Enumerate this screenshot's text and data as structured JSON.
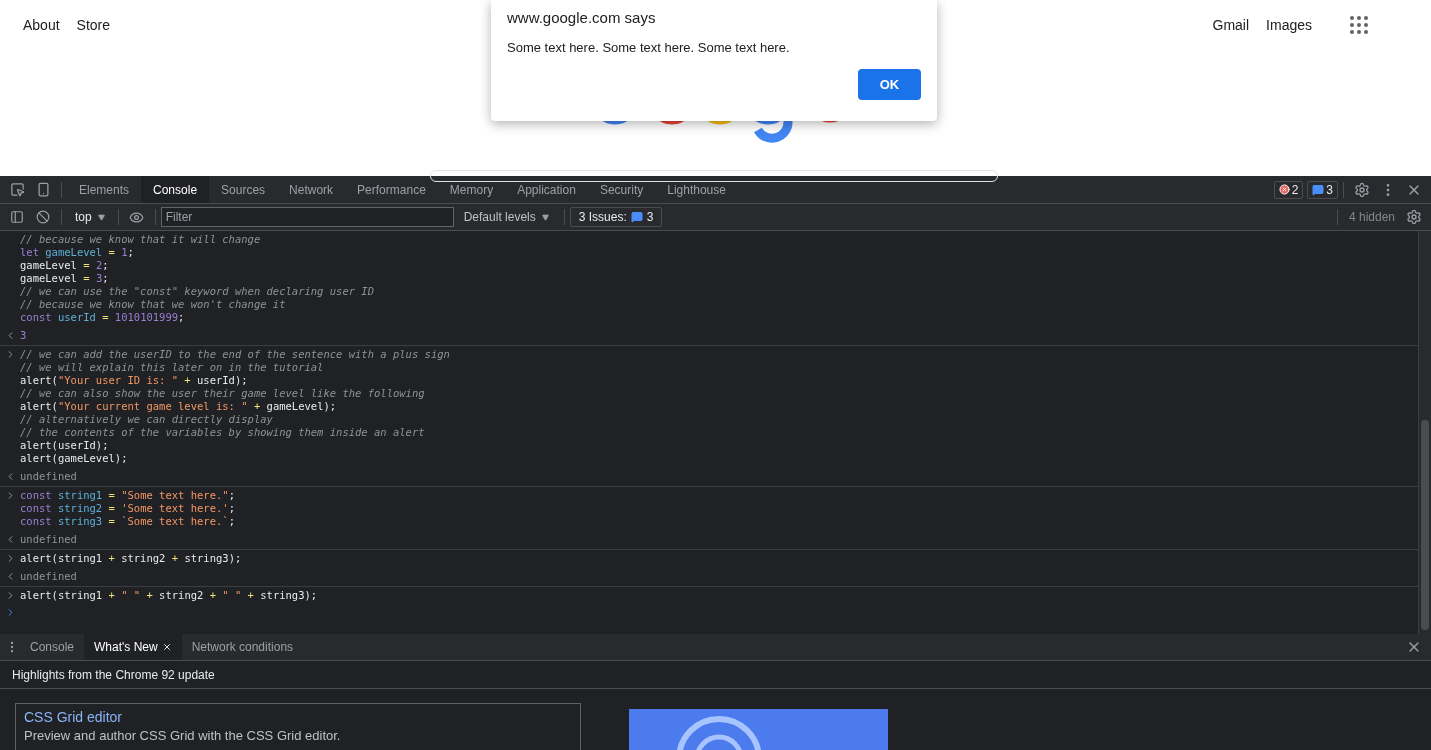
{
  "page": {
    "nav_left": [
      "About",
      "Store"
    ],
    "nav_right": [
      "Gmail",
      "Images"
    ]
  },
  "alert": {
    "origin": "www.google.com says",
    "message": "Some text here. Some text here. Some text here.",
    "button": "OK"
  },
  "devtools": {
    "tabs": [
      {
        "label": "Elements",
        "selected": false
      },
      {
        "label": "Console",
        "selected": true
      },
      {
        "label": "Sources",
        "selected": false
      },
      {
        "label": "Network",
        "selected": false
      },
      {
        "label": "Performance",
        "selected": false
      },
      {
        "label": "Memory",
        "selected": false
      },
      {
        "label": "Application",
        "selected": false
      },
      {
        "label": "Security",
        "selected": false
      },
      {
        "label": "Lighthouse",
        "selected": false
      }
    ],
    "error_count": "2",
    "message_count": "3"
  },
  "console_toolbar": {
    "context": "top",
    "filter_placeholder": "Filter",
    "levels": "Default levels",
    "issues_label": "3 Issues:",
    "issues_count": "3",
    "hidden": "4 hidden"
  },
  "console": {
    "entries": [
      {
        "kind": "continued",
        "lines": [
          [
            {
              "kind": "comment",
              "text": "// because we know that it will change"
            }
          ],
          [
            {
              "kind": "keyword",
              "text": "let "
            },
            {
              "kind": "variable",
              "text": "gameLevel"
            },
            {
              "kind": "operator",
              "text": " = "
            },
            {
              "kind": "number",
              "text": "1"
            },
            {
              "kind": "plain",
              "text": ";"
            }
          ],
          [
            {
              "kind": "plain",
              "text": "gameLevel"
            },
            {
              "kind": "operator",
              "text": " = "
            },
            {
              "kind": "number",
              "text": "2"
            },
            {
              "kind": "plain",
              "text": ";"
            }
          ],
          [
            {
              "kind": "plain",
              "text": "gameLevel"
            },
            {
              "kind": "operator",
              "text": " = "
            },
            {
              "kind": "number",
              "text": "3"
            },
            {
              "kind": "plain",
              "text": ";"
            }
          ],
          [
            {
              "kind": "comment",
              "text": "// we can use the \"const\" keyword when declaring user ID"
            }
          ],
          [
            {
              "kind": "comment",
              "text": "// because we know that we won't change it"
            }
          ],
          [
            {
              "kind": "keyword",
              "text": "const "
            },
            {
              "kind": "variable",
              "text": "userId"
            },
            {
              "kind": "operator",
              "text": " = "
            },
            {
              "kind": "number",
              "text": "1010101999"
            },
            {
              "kind": "plain",
              "text": ";"
            }
          ]
        ]
      },
      {
        "kind": "result",
        "lines": [
          [
            {
              "kind": "number",
              "text": "3"
            }
          ]
        ]
      },
      {
        "kind": "input",
        "lines": [
          [
            {
              "kind": "comment",
              "text": "// we can add the userID to the end of the sentence with a plus sign"
            }
          ],
          [
            {
              "kind": "comment",
              "text": "// we will explain this later on in the tutorial"
            }
          ],
          [
            {
              "kind": "plain",
              "text": "alert("
            },
            {
              "kind": "string",
              "text": "\"Your user ID is: \""
            },
            {
              "kind": "operator",
              "text": " + "
            },
            {
              "kind": "plain",
              "text": "userId);"
            }
          ],
          [
            {
              "kind": "comment",
              "text": "// we can also show the user their game level like the following"
            }
          ],
          [
            {
              "kind": "plain",
              "text": "alert("
            },
            {
              "kind": "string",
              "text": "\"Your current game level is: \""
            },
            {
              "kind": "operator",
              "text": " + "
            },
            {
              "kind": "plain",
              "text": "gameLevel);"
            }
          ],
          [
            {
              "kind": "comment",
              "text": "// alternatively we can directly display"
            }
          ],
          [
            {
              "kind": "comment",
              "text": "// the contents of the variables by showing them inside an alert"
            }
          ],
          [
            {
              "kind": "plain",
              "text": "alert(userId);"
            }
          ],
          [
            {
              "kind": "plain",
              "text": "alert(gameLevel);"
            }
          ]
        ]
      },
      {
        "kind": "result",
        "lines": [
          [
            {
              "kind": "undefined",
              "text": "undefined"
            }
          ]
        ]
      },
      {
        "kind": "input",
        "lines": [
          [
            {
              "kind": "keyword",
              "text": "const "
            },
            {
              "kind": "variable",
              "text": "string1"
            },
            {
              "kind": "operator",
              "text": " = "
            },
            {
              "kind": "string",
              "text": "\"Some text here.\""
            },
            {
              "kind": "plain",
              "text": ";"
            }
          ],
          [
            {
              "kind": "keyword",
              "text": "const "
            },
            {
              "kind": "variable",
              "text": "string2"
            },
            {
              "kind": "operator",
              "text": " = "
            },
            {
              "kind": "string",
              "text": "'Some text here.'"
            },
            {
              "kind": "plain",
              "text": ";"
            }
          ],
          [
            {
              "kind": "keyword",
              "text": "const "
            },
            {
              "kind": "variable",
              "text": "string3"
            },
            {
              "kind": "operator",
              "text": " = "
            },
            {
              "kind": "string",
              "text": "`Some text here.`"
            },
            {
              "kind": "plain",
              "text": ";"
            }
          ]
        ]
      },
      {
        "kind": "result",
        "lines": [
          [
            {
              "kind": "undefined",
              "text": "undefined"
            }
          ]
        ]
      },
      {
        "kind": "input",
        "lines": [
          [
            {
              "kind": "plain",
              "text": "alert(string1"
            },
            {
              "kind": "operator",
              "text": " + "
            },
            {
              "kind": "plain",
              "text": "string2"
            },
            {
              "kind": "operator",
              "text": " + "
            },
            {
              "kind": "plain",
              "text": "string3);"
            }
          ]
        ]
      },
      {
        "kind": "result",
        "lines": [
          [
            {
              "kind": "undefined",
              "text": "undefined"
            }
          ]
        ]
      },
      {
        "kind": "input",
        "lines": [
          [
            {
              "kind": "plain",
              "text": "alert(string1"
            },
            {
              "kind": "operator",
              "text": " + "
            },
            {
              "kind": "string",
              "text": "\" \""
            },
            {
              "kind": "operator",
              "text": " + "
            },
            {
              "kind": "plain",
              "text": "string2"
            },
            {
              "kind": "operator",
              "text": " + "
            },
            {
              "kind": "string",
              "text": "\" \""
            },
            {
              "kind": "operator",
              "text": " + "
            },
            {
              "kind": "plain",
              "text": "string3);"
            }
          ]
        ]
      },
      {
        "kind": "prompt"
      }
    ]
  },
  "drawer": {
    "tabs": [
      {
        "label": "Console",
        "selected": false,
        "closable": false
      },
      {
        "label": "What's New",
        "selected": true,
        "closable": true
      },
      {
        "label": "Network conditions",
        "selected": false,
        "closable": false
      }
    ],
    "heading": "Highlights from the Chrome 92 update",
    "feature": {
      "title": "CSS Grid editor",
      "description": "Preview and author CSS Grid with the CSS Grid editor."
    }
  }
}
